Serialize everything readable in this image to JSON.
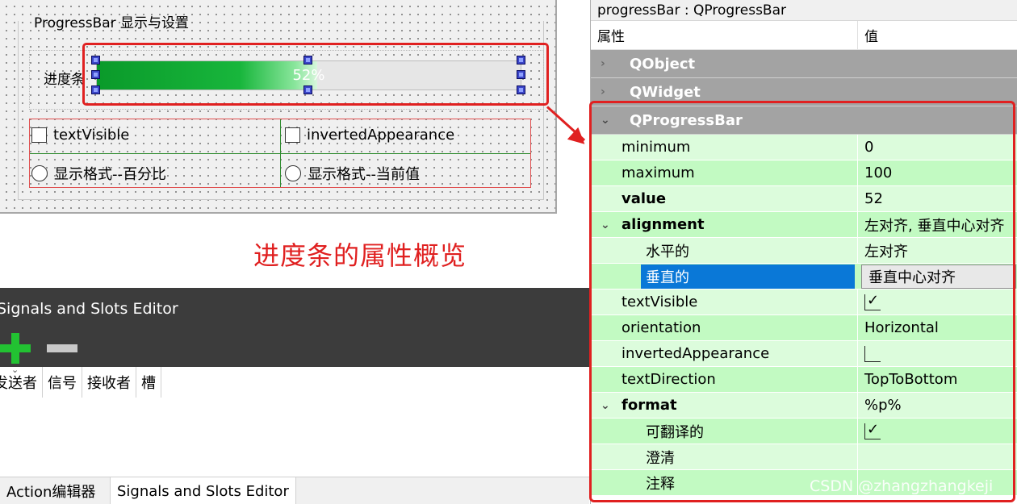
{
  "form": {
    "group_title": "ProgressBar 显示与设置",
    "progress_label": "进度条",
    "progress_text": "52%",
    "progress_value": 52,
    "checkbox_text_visible": "textVisible",
    "checkbox_inverted": "invertedAppearance",
    "radio_percent": "显示格式--百分比",
    "radio_current": "显示格式--当前值"
  },
  "caption": "进度条的属性概览",
  "signals_slots": {
    "title": "Signals and Slots Editor",
    "add_icon": "plus-icon",
    "remove_icon": "minus-icon",
    "columns": [
      "发送者",
      "信号",
      "接收者",
      "槽"
    ]
  },
  "bottom_tabs": [
    "Action编辑器",
    "Signals and Slots Editor"
  ],
  "property_editor": {
    "object_title": "progressBar : QProgressBar",
    "col_property": "属性",
    "col_value": "值",
    "groups": {
      "qobject": "QObject",
      "qwidget": "QWidget",
      "qprogressbar": "QProgressBar"
    },
    "rows": {
      "minimum": {
        "name": "minimum",
        "value": "0"
      },
      "maximum": {
        "name": "maximum",
        "value": "100"
      },
      "value": {
        "name": "value",
        "value": "52"
      },
      "alignment": {
        "name": "alignment",
        "value": "左对齐, 垂直中心对齐"
      },
      "horizontal": {
        "name": "水平的",
        "value": "左对齐"
      },
      "vertical": {
        "name": "垂直的",
        "value": "垂直中心对齐"
      },
      "text_visible": {
        "name": "textVisible",
        "checked": true
      },
      "orientation": {
        "name": "orientation",
        "value": "Horizontal"
      },
      "inverted_appearance": {
        "name": "invertedAppearance",
        "checked": false
      },
      "text_direction": {
        "name": "textDirection",
        "value": "TopToBottom"
      },
      "format": {
        "name": "format",
        "value": "%p%"
      },
      "translatable": {
        "name": "可翻译的",
        "checked": true
      },
      "disambiguation": {
        "name": "澄清",
        "value": ""
      },
      "comment": {
        "name": "注释",
        "value": ""
      }
    }
  },
  "watermark": "CSDN @zhangzhangkeji",
  "colors": {
    "annotation_red": "#e02020",
    "row_light": "#dcfcdc",
    "row_dark": "#c2fac2",
    "selection_blue": "#0a78d7",
    "group_gray": "#a3a3a3",
    "progress_green": "#18b63c"
  }
}
